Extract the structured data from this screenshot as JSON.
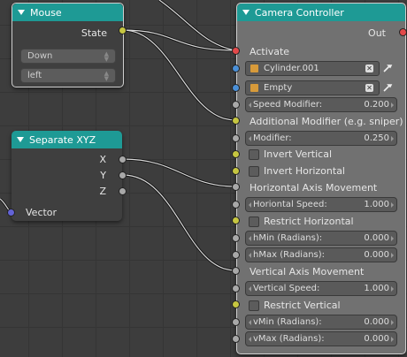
{
  "mouse": {
    "title": "Mouse",
    "state": "State",
    "event": "Down",
    "button": "left"
  },
  "separate": {
    "title": "Separate XYZ",
    "x": "X",
    "y": "Y",
    "z": "Z",
    "vector": "Vector"
  },
  "camera": {
    "title": "Camera Controller",
    "out": "Out",
    "activate": "Activate",
    "obj1": "Cylinder.001",
    "obj2": "Empty",
    "speed_modifier": {
      "label": "Speed Modifier:",
      "value": "0.200"
    },
    "additional_modifier": "Additional Modifier (e.g. sniper)",
    "modifier": {
      "label": "Modifier:",
      "value": "0.250"
    },
    "invert_vertical": "Invert Vertical",
    "invert_horizontal": "Invert Horizontal",
    "horizontal_axis": "Horizontal Axis Movement",
    "horizontal_speed": {
      "label": "Horiontal Speed:",
      "value": "1.000"
    },
    "restrict_horizontal": "Restrict Horizontal",
    "hmin": {
      "label": "hMin (Radians):",
      "value": "0.000"
    },
    "hmax": {
      "label": "hMax (Radians):",
      "value": "0.000"
    },
    "vertical_axis": "Vertical Axis Movement",
    "vertical_speed": {
      "label": "Vertical Speed:",
      "value": "1.000"
    },
    "restrict_vertical": "Restrict Vertical",
    "vmin": {
      "label": "vMin (Radians):",
      "value": "0.000"
    },
    "vmax": {
      "label": "vMax (Radians):",
      "value": "0.000"
    }
  }
}
